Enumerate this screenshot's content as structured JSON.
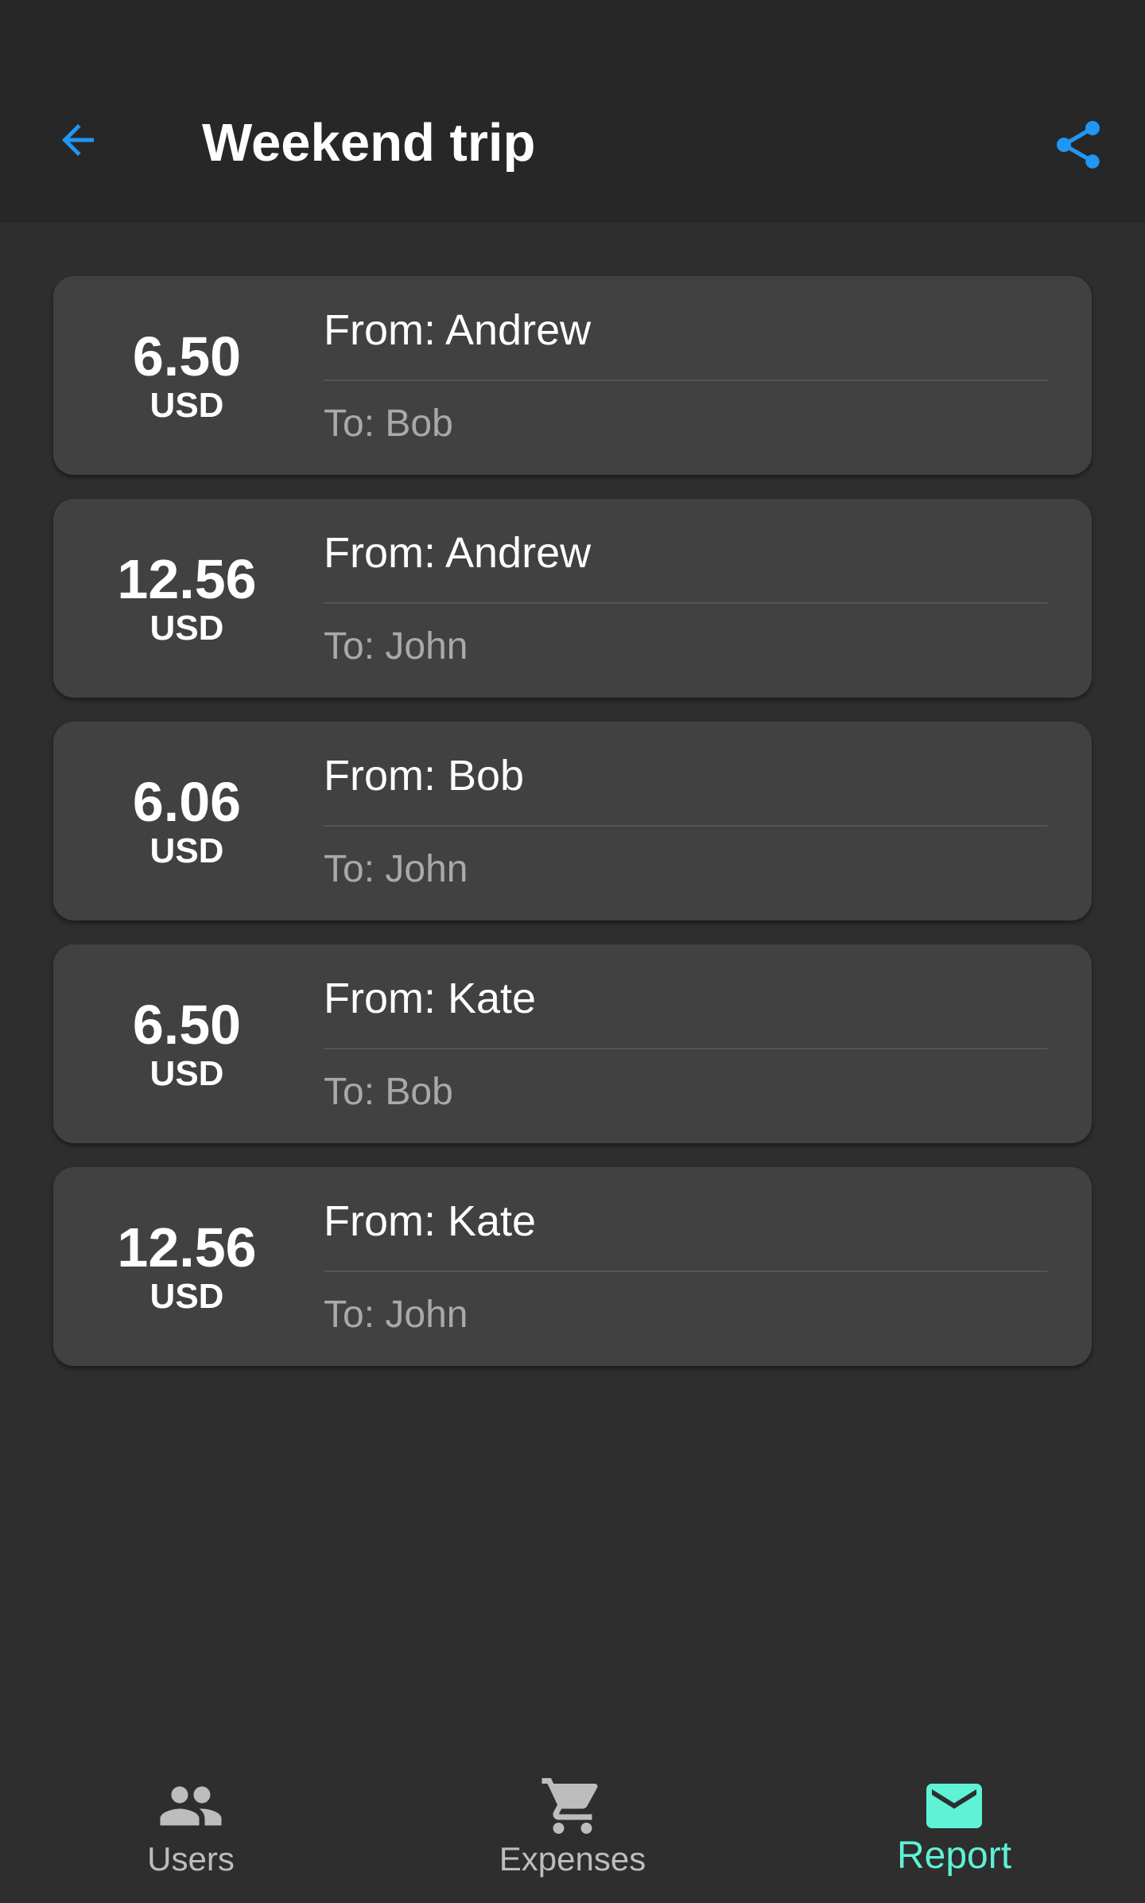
{
  "app_bar": {
    "title": "Weekend trip",
    "back_icon": "arrow-back-icon",
    "share_icon": "share-icon",
    "accent_color": "#2196f3"
  },
  "transfers": [
    {
      "amount": "6.50",
      "currency": "USD",
      "from": "From: Andrew",
      "to": "To: Bob"
    },
    {
      "amount": "12.56",
      "currency": "USD",
      "from": "From: Andrew",
      "to": "To: John"
    },
    {
      "amount": "6.06",
      "currency": "USD",
      "from": "From: Bob",
      "to": "To: John"
    },
    {
      "amount": "6.50",
      "currency": "USD",
      "from": "From: Kate",
      "to": "To: Bob"
    },
    {
      "amount": "12.56",
      "currency": "USD",
      "from": "From: Kate",
      "to": "To: John"
    }
  ],
  "bottom_nav": {
    "items": [
      {
        "label": "Users",
        "icon": "users-icon",
        "active": false
      },
      {
        "label": "Expenses",
        "icon": "cart-icon",
        "active": false
      },
      {
        "label": "Report",
        "icon": "mail-icon",
        "active": true
      }
    ],
    "active_color": "#5ef2d6"
  }
}
